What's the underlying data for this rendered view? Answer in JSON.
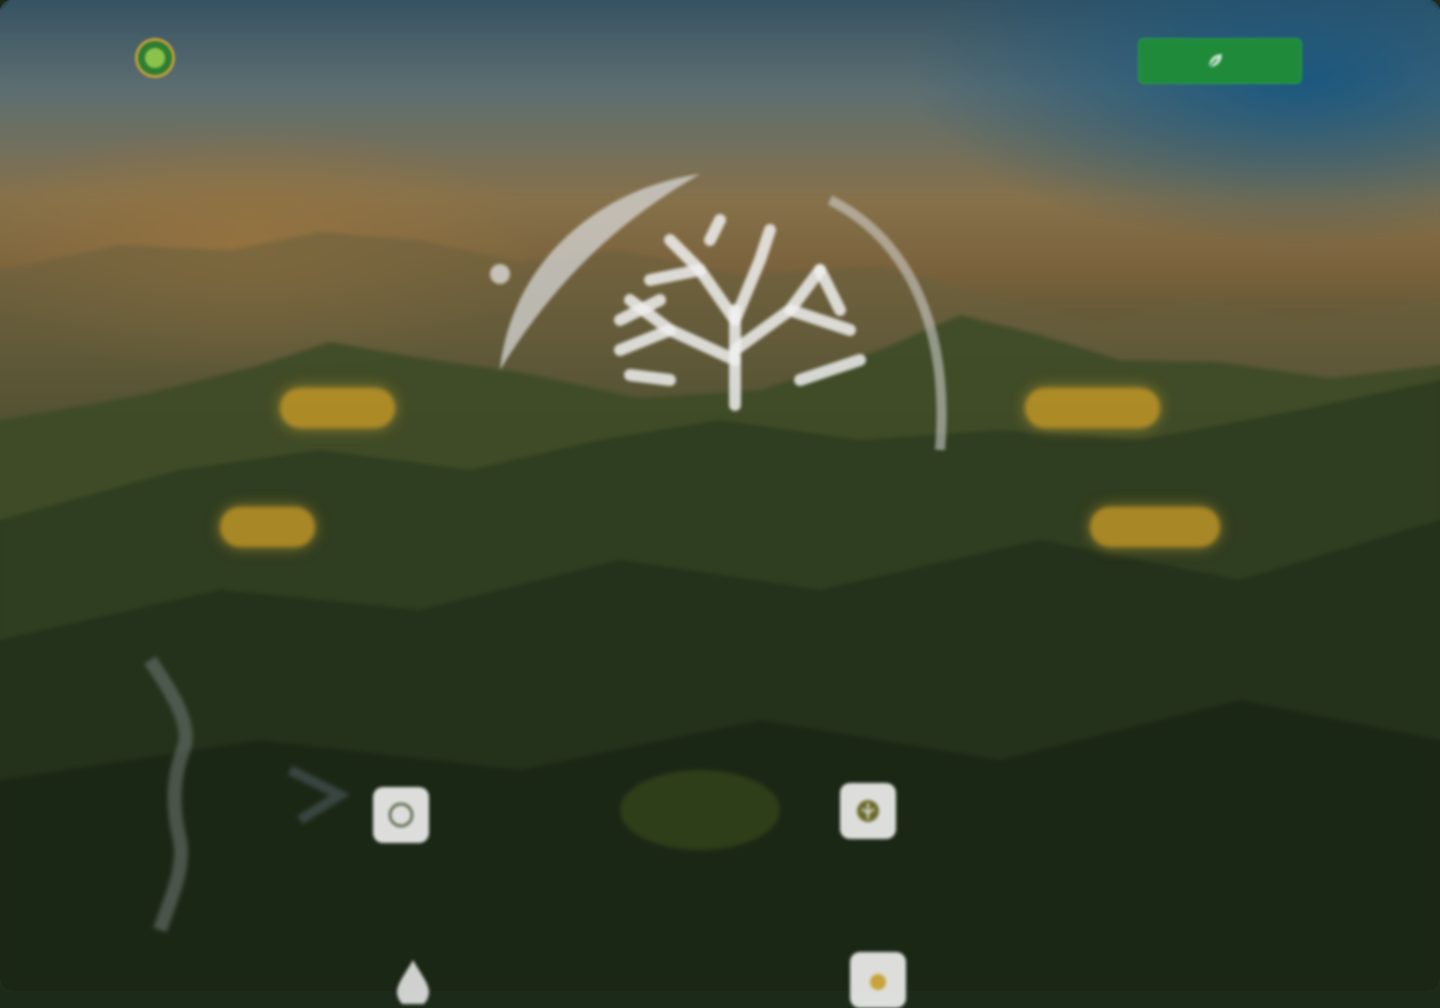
{
  "header": {
    "logo": {
      "name": "",
      "tagline": ""
    },
    "nav": [
      "",
      "",
      "",
      ""
    ],
    "cta_label": ""
  },
  "hero": {
    "pills": [
      "",
      "",
      "",
      ""
    ]
  },
  "stats": [
    {
      "icon": "co2-icon",
      "label": "",
      "value": ""
    },
    {
      "icon": "tree-badge-icon",
      "label": "",
      "value": ""
    },
    {
      "icon": "water-drop-icon",
      "label": "",
      "value": ""
    },
    {
      "icon": "medal-icon",
      "label": "",
      "value": ""
    }
  ],
  "colors": {
    "brand_green": "#1e8a3a",
    "logo_green": "#7cb342",
    "pill_gold": "#d2a028",
    "overlay": "#0a100e"
  }
}
